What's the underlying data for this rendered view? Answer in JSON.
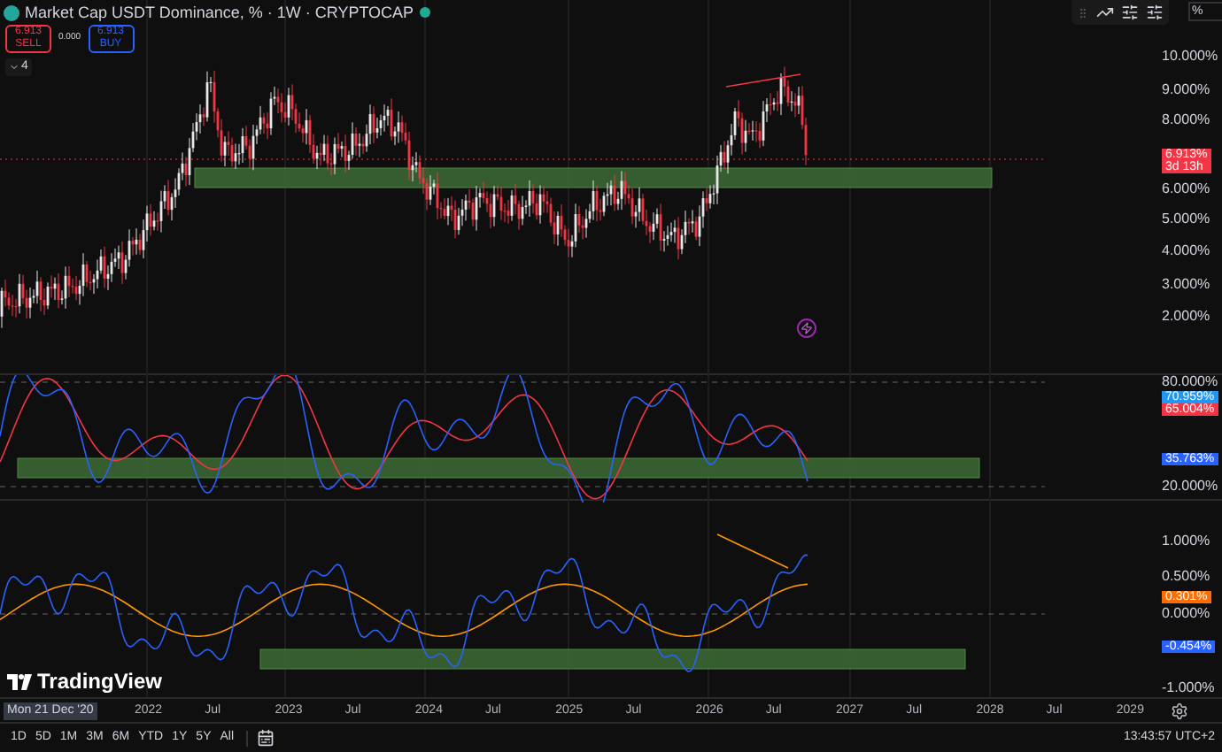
{
  "header": {
    "title": "Market Cap USDT Dominance, % · 1W · CRYPTOCAP",
    "sell": {
      "price": "6.913",
      "label": "SELL"
    },
    "spread": "0.000",
    "buy": {
      "price": "6.913",
      "label": "BUY"
    },
    "indicator_count": "4"
  },
  "toolbar": {
    "scale_field": "%"
  },
  "panes": [
    {
      "axis_labels": [
        "10.000%",
        "9.000%",
        "8.000%",
        "6.000%",
        "5.000%",
        "4.000%",
        "3.000%",
        "2.000%"
      ],
      "tags": [
        {
          "text": "6.913%",
          "subtext": "3d 13h",
          "color": "#f23645"
        }
      ]
    },
    {
      "axis_labels": [
        "80.000%",
        "20.000%"
      ],
      "tags": [
        {
          "text": "70.959%",
          "color": "#2196f3"
        },
        {
          "text": "65.004%",
          "color": "#f23645"
        },
        {
          "text": "35.763%",
          "color": "#2962ff"
        }
      ]
    },
    {
      "axis_labels": [
        "1.000%",
        "0.500%",
        "0.000%",
        "-1.000%"
      ],
      "tags": [
        {
          "text": "0.301%",
          "color": "#ff6d00"
        },
        {
          "text": "-0.454%",
          "color": "#2962ff"
        }
      ]
    }
  ],
  "logo": "TradingView",
  "time_axis": {
    "cursor_date": "Mon 21 Dec '20",
    "labels": [
      "2022",
      "Jul",
      "2023",
      "Jul",
      "2024",
      "Jul",
      "2025",
      "Jul",
      "2026",
      "Jul",
      "2027",
      "Jul",
      "2028",
      "Jul",
      "2029"
    ]
  },
  "ranges": [
    "1D",
    "5D",
    "1M",
    "3M",
    "6M",
    "YTD",
    "1Y",
    "5Y",
    "All"
  ],
  "clock": "13:43:57 UTC+2"
}
